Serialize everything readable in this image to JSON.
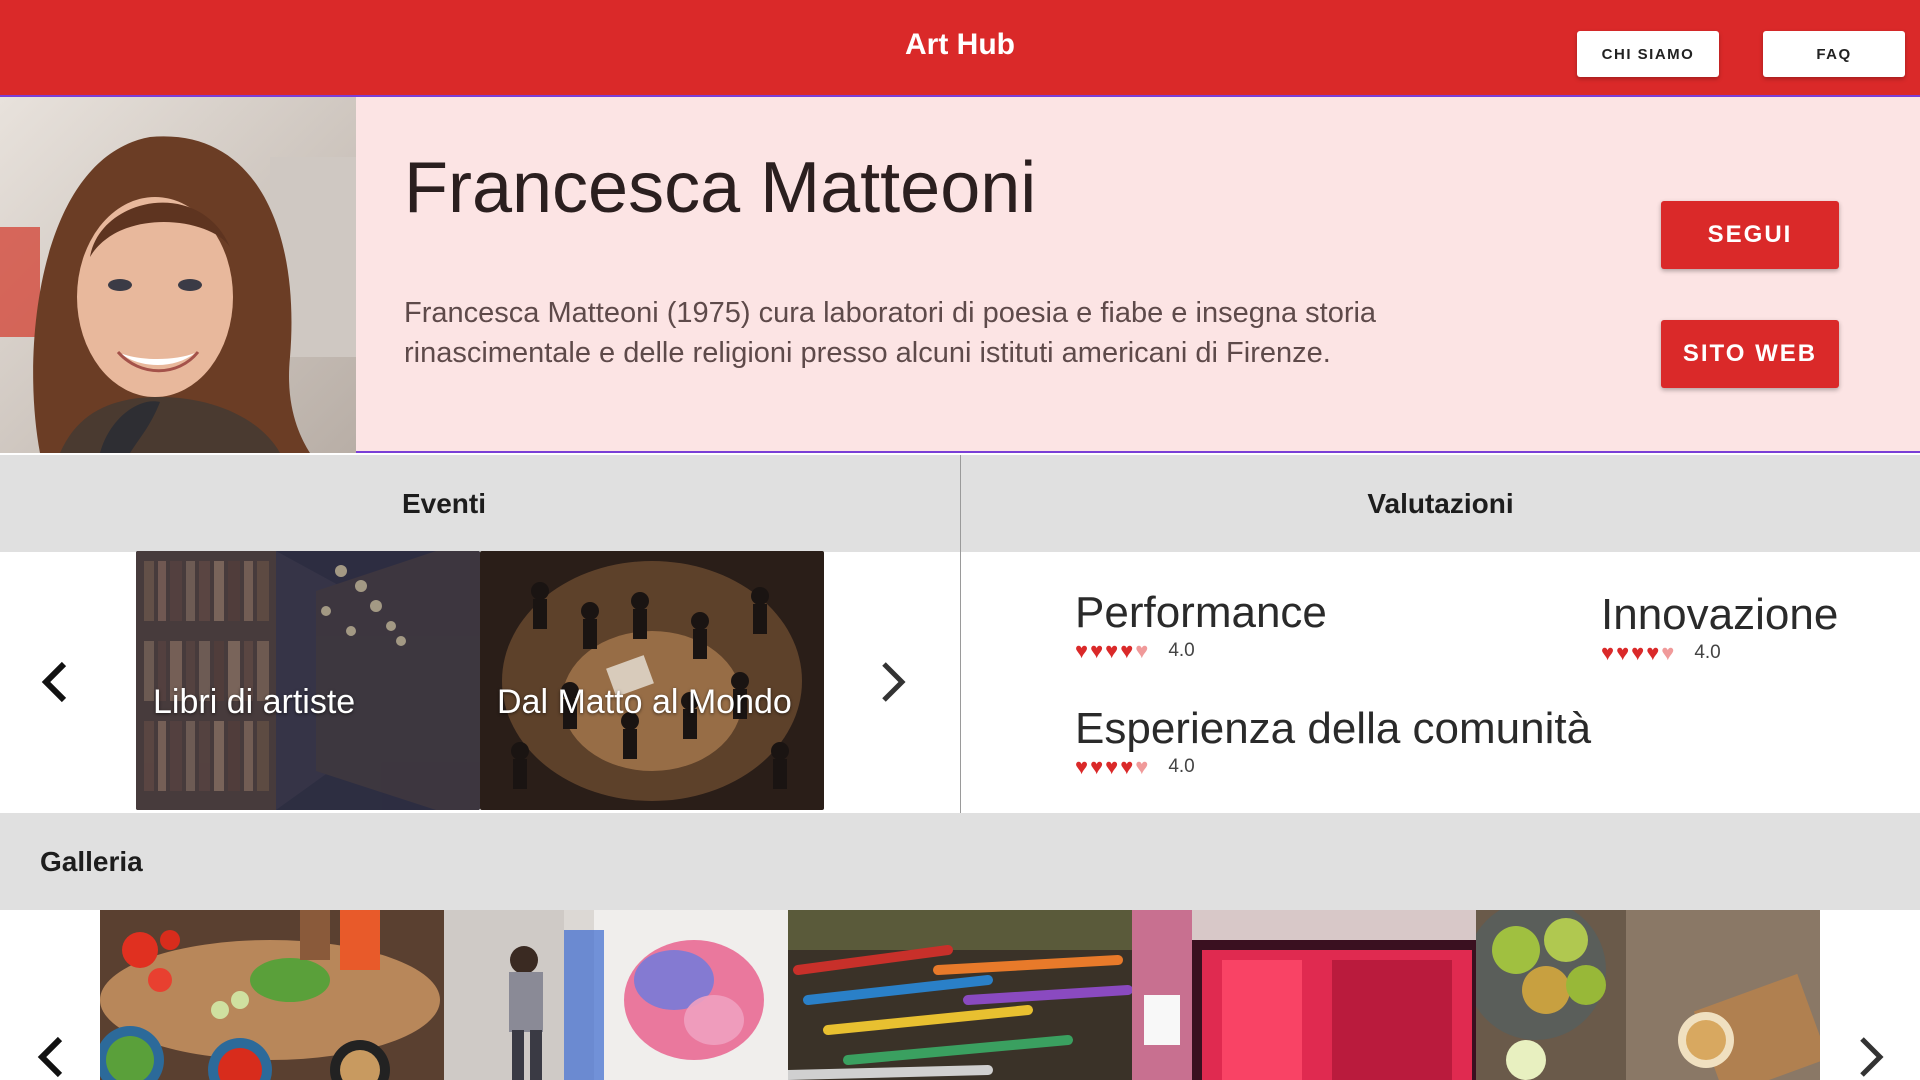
{
  "header": {
    "title": "Art Hub",
    "nav": [
      {
        "label": "CHI SIAMO"
      },
      {
        "label": "FAQ"
      }
    ],
    "bg_color": "#da2929"
  },
  "profile": {
    "name": "Francesca Matteoni",
    "bio": "Francesca Matteoni (1975) cura laboratori di poesia e fiabe e insegna storia rinascimentale e delle religioni presso alcuni istituti americani di Firenze.",
    "follow_label": "SEGUI",
    "website_label": "SITO WEB",
    "bg_color": "#fce4e4"
  },
  "events": {
    "heading": "Eventi",
    "items": [
      {
        "title": "Libri di artiste"
      },
      {
        "title": "Dal Matto al Mondo"
      }
    ],
    "prev_icon": "chevron-left-icon",
    "next_icon": "chevron-right-icon"
  },
  "ratings": {
    "heading": "Valutazioni",
    "items": [
      {
        "label": "Performance",
        "value": "4.0",
        "stars": 4,
        "max": 5
      },
      {
        "label": "Innovazione",
        "value": "4.0",
        "stars": 4,
        "max": 5
      },
      {
        "label": "Esperienza della comunità",
        "value": "4.0",
        "stars": 4,
        "max": 5
      }
    ],
    "heart_color": "#da2929"
  },
  "gallery": {
    "heading": "Galleria",
    "prev_icon": "chevron-left-icon",
    "next_icon": "chevron-right-icon"
  }
}
